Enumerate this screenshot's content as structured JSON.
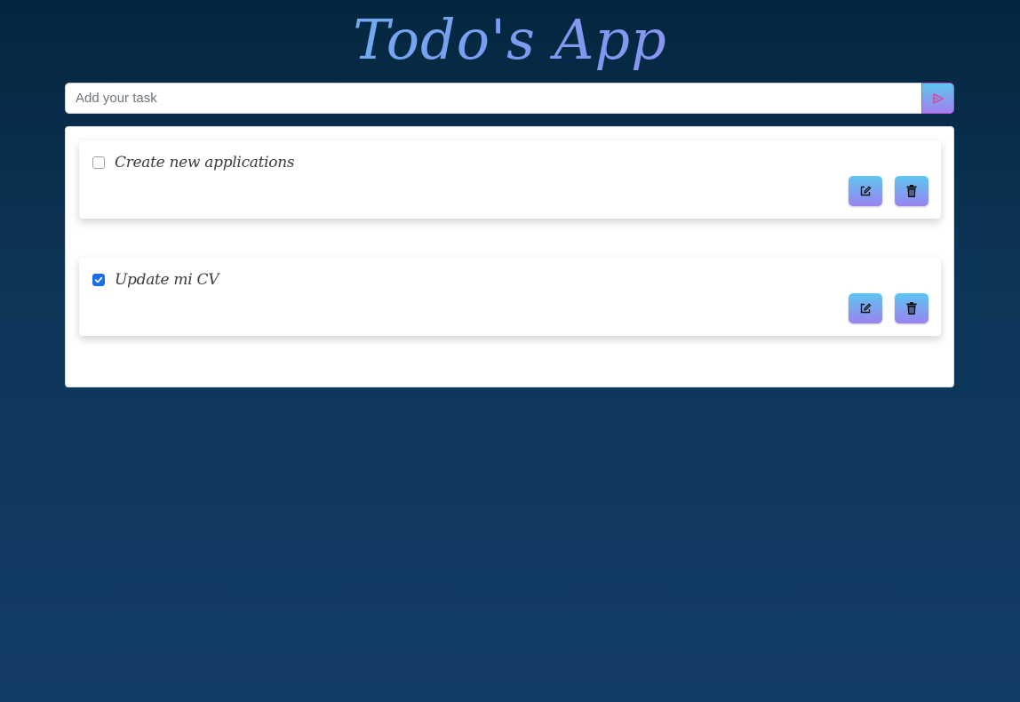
{
  "app": {
    "title": "Todo's App"
  },
  "add_task": {
    "placeholder": "Add your task",
    "value": ""
  },
  "tasks": [
    {
      "label": "Create new applications",
      "completed": false
    },
    {
      "label": "Update mi CV",
      "completed": true
    }
  ],
  "icons": {
    "submit": "send-icon",
    "edit": "edit-icon",
    "delete": "trash-icon",
    "check": "check-icon"
  },
  "colors": {
    "accent_start": "#5dc6f0",
    "accent_end": "#a27ef0",
    "checkbox_checked": "#1a6fe8",
    "background_top": "#04263f",
    "background_bottom": "#123d66"
  }
}
